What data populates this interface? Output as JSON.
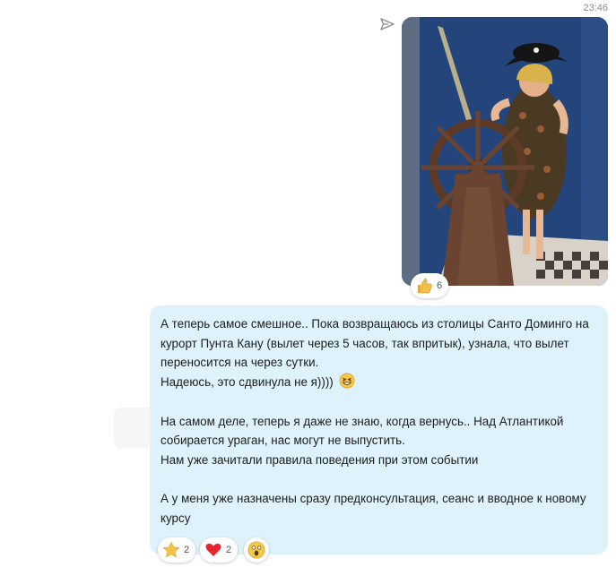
{
  "message_time": "23:46",
  "photo_message": {
    "sent_status_icon": "send-arrow-icon",
    "reactions": [
      {
        "icon": "thumbs-up-icon",
        "count": "6"
      }
    ]
  },
  "text_message": {
    "lines": [
      "А теперь самое смешное.. Пока возвращаюсь из столицы Санто Доминго на",
      "курорт Пунта Кану (вылет через 5 часов, так впритык), узнала, что вылет",
      "переносится на через сутки.",
      "Надеюсь, это сдвинула не я))))",
      "На самом деле, теперь я даже не знаю, когда вернусь.. Над Атлантикой",
      "собирается ураган, нас могут не выпустить.",
      "Нам уже зачитали правила поведения при этом событии",
      "А у меня уже назначены сразу предконсультация, сеанс и вводное к новому",
      "курсу"
    ],
    "inline_emoji": "laughing-face-icon",
    "bubble_color": "#def2fc",
    "reactions": [
      {
        "icon": "star-icon",
        "count": "2"
      },
      {
        "icon": "heart-icon",
        "count": "2"
      },
      {
        "icon": "surprised-face-icon",
        "count": ""
      }
    ]
  }
}
